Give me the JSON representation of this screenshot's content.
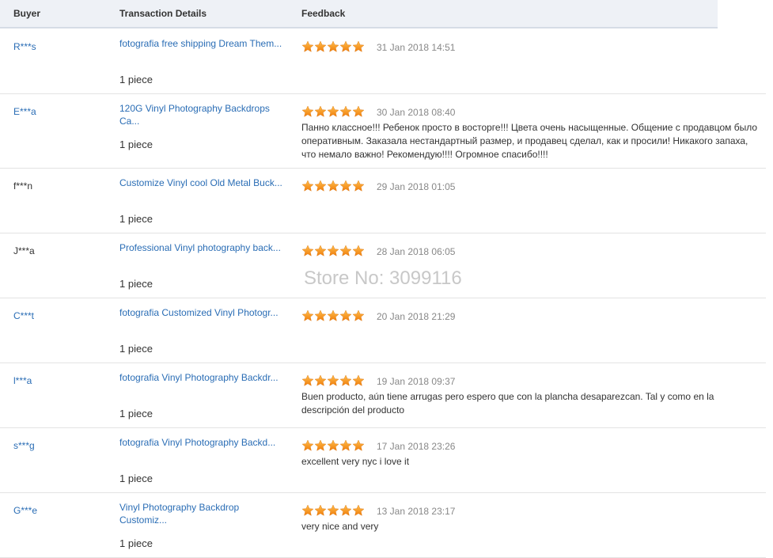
{
  "header": {
    "buyer": "Buyer",
    "transaction": "Transaction Details",
    "feedback": "Feedback"
  },
  "colors": {
    "link": "#2a6db5",
    "star": "#f29a1f",
    "header_bg": "#eef1f6"
  },
  "watermark": "Store No: 3099116",
  "rows": [
    {
      "buyer": "R***s",
      "buyer_link": true,
      "product": "fotografia free shipping Dream Them...",
      "qty": "1 piece",
      "rating": 5,
      "date": "31 Jan 2018 14:51",
      "comment": ""
    },
    {
      "buyer": "E***a",
      "buyer_link": true,
      "product": "120G Vinyl Photography Backdrops\nCa...",
      "qty": "1 piece",
      "rating": 5,
      "date": "30 Jan 2018 08:40",
      "comment": "Панно классное!!! Ребенок просто в восторге!!! Цвета очень насыщенные. Общение с продавцом было оперативным. Заказала нестандартный размер, и продавец сделал, как и просили! Никакого запаха, что немало важно! Рекомендую!!!! Огромное спасибо!!!!"
    },
    {
      "buyer": "f***n",
      "buyer_link": false,
      "product": "Customize Vinyl cool Old Metal Buck...",
      "qty": "1 piece",
      "rating": 5,
      "date": "29 Jan 2018 01:05",
      "comment": ""
    },
    {
      "buyer": "J***a",
      "buyer_link": false,
      "product": "Professional Vinyl photography back...",
      "qty": "1 piece",
      "rating": 5,
      "date": "28 Jan 2018 06:05",
      "comment": ""
    },
    {
      "buyer": "C***t",
      "buyer_link": true,
      "product": "fotografia Customized Vinyl Photogr...",
      "qty": "1 piece",
      "rating": 5,
      "date": "20 Jan 2018 21:29",
      "comment": ""
    },
    {
      "buyer": "l***a",
      "buyer_link": true,
      "product": "fotografia Vinyl Photography Backdr...",
      "qty": "1 piece",
      "rating": 5,
      "date": "19 Jan 2018 09:37",
      "comment": "Buen producto, aún tiene arrugas pero espero que con la plancha desaparezcan. Tal y como en la descripción del producto"
    },
    {
      "buyer": "s***g",
      "buyer_link": true,
      "product": "fotografia Vinyl Photography Backd...",
      "qty": "1 piece",
      "rating": 5,
      "date": "17 Jan 2018 23:26",
      "comment": "excellent very nyc i love it"
    },
    {
      "buyer": "G***e",
      "buyer_link": true,
      "product": "Vinyl Photography Backdrop\nCustomiz...",
      "qty": "1 piece",
      "rating": 5,
      "date": "13 Jan 2018 23:17",
      "comment": "very nice and very"
    }
  ]
}
